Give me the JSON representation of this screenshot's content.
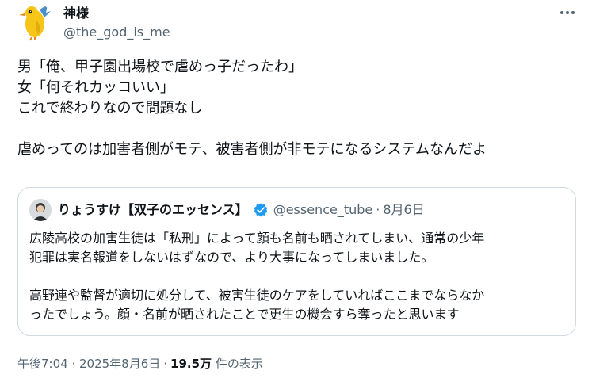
{
  "author": {
    "display_name": "神様",
    "handle": "@the_god_is_me"
  },
  "tweet": {
    "text": "男「俺、甲子園出場校で虐めっ子だったわ」\n女「何それカッコいい」\nこれで終わりなので問題なし\n\n虐めってのは加害者側がモテ、被害者側が非モテになるシステムなんだよ"
  },
  "quote": {
    "display_name": "りょうすけ【双子のエッセンス】",
    "handle": "@essence_tube",
    "separator": "·",
    "date": "8月6日",
    "text": "広陵高校の加害生徒は「私刑」によって顔も名前も晒されてしまい、通常の少年\n犯罪は実名報道をしないはずなので、より大事になってしまいました。\n\n高野連や監督が適切に処分して、被害生徒のケアをしていればここまでならなか\nったでしょう。顔・名前が晒されたことで更生の機会すら奪ったと思います"
  },
  "meta": {
    "timestamp": "午後7:04 · 2025年8月6日",
    "separator": "·",
    "views_count": "19.5万",
    "views_label": "件の表示"
  },
  "icons": {
    "more": "more-horizontal-icon",
    "verified": "verified-badge-icon"
  },
  "colors": {
    "text_primary": "#0f1419",
    "text_secondary": "#536471",
    "border": "#cfd9de",
    "verified_blue": "#1d9bf0",
    "bird_yellow": "#f5c518",
    "bird_blue": "#4a90c8"
  }
}
